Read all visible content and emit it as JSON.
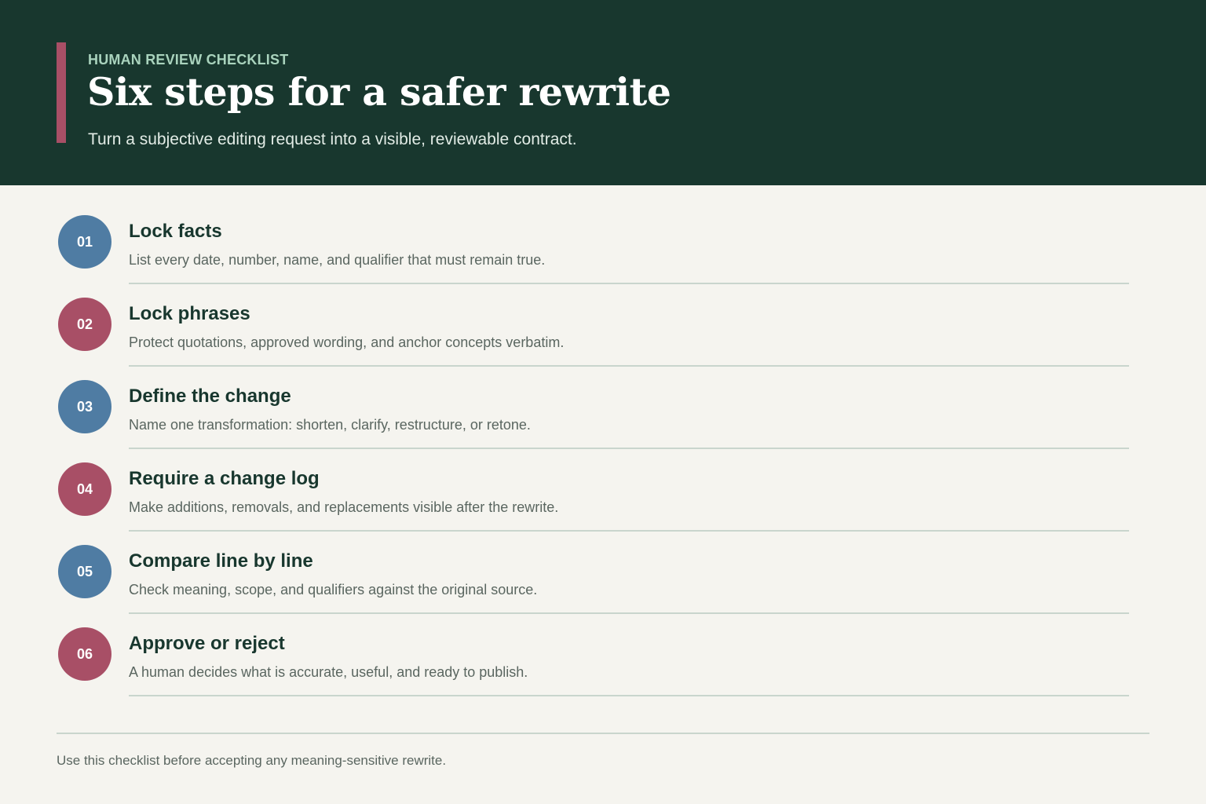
{
  "header": {
    "eyebrow": "HUMAN REVIEW CHECKLIST",
    "title": "Six steps for a safer rewrite",
    "subtitle": "Turn a subjective editing request into a visible, reviewable contract."
  },
  "steps": [
    {
      "number": "01",
      "title": "Lock facts",
      "description": "List every date, number, name, and qualifier that must remain true.",
      "color": "#4f7ca3"
    },
    {
      "number": "02",
      "title": "Lock phrases",
      "description": "Protect quotations, approved wording, and anchor concepts verbatim.",
      "color": "#a84f66"
    },
    {
      "number": "03",
      "title": "Define the change",
      "description": "Name one transformation: shorten, clarify, restructure, or retone.",
      "color": "#4f7ca3"
    },
    {
      "number": "04",
      "title": "Require a change log",
      "description": "Make additions, removals, and replacements visible after the rewrite.",
      "color": "#a84f66"
    },
    {
      "number": "05",
      "title": "Compare line by line",
      "description": "Check meaning, scope, and qualifiers against the original source.",
      "color": "#4f7ca3"
    },
    {
      "number": "06",
      "title": "Approve or reject",
      "description": "A human decides what is accurate, useful, and ready to publish.",
      "color": "#a84f66"
    }
  ],
  "footer": {
    "note": "Use this checklist before accepting any meaning-sensitive rewrite."
  },
  "colors": {
    "header_bg": "#18372e",
    "accent_blue": "#4f7ca3",
    "accent_rose": "#a84f66",
    "page_bg": "#f5f4ef"
  }
}
